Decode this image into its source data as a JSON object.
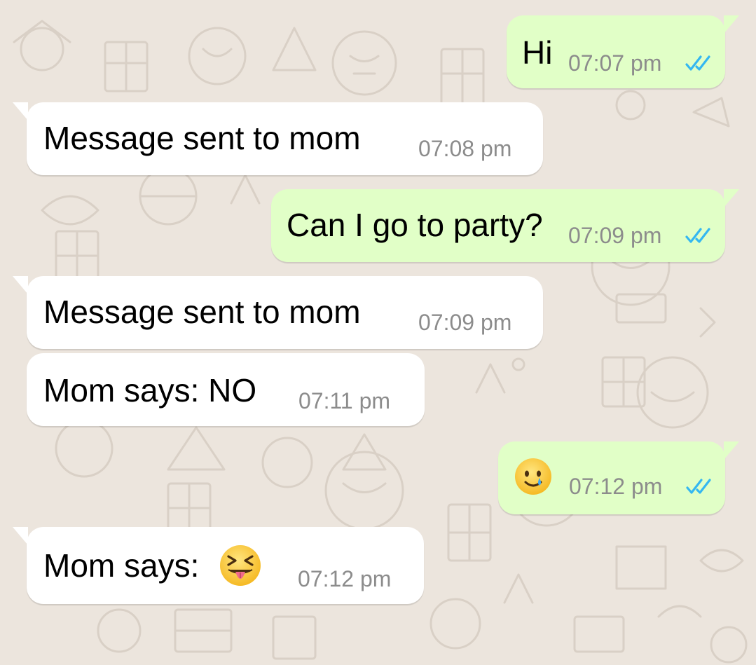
{
  "chat": {
    "messages": [
      {
        "direction": "outgoing",
        "text": "Hi",
        "time": "07:07 pm",
        "status_icon": "double-check-read-icon"
      },
      {
        "direction": "incoming",
        "text": "Message sent to mom",
        "time": "07:08 pm"
      },
      {
        "direction": "outgoing",
        "text": "Can I go to party?",
        "time": "07:09 pm",
        "status_icon": "double-check-read-icon"
      },
      {
        "direction": "incoming",
        "text": "Message sent to mom",
        "time": "07:09 pm"
      },
      {
        "direction": "incoming",
        "text": "Mom says: NO",
        "time": "07:11 pm"
      },
      {
        "direction": "outgoing",
        "emoji": "smiling-face-with-tear-emoji",
        "time": "07:12 pm",
        "status_icon": "double-check-read-icon"
      },
      {
        "direction": "incoming",
        "text": "Mom says:",
        "emoji": "squinting-face-with-tongue-emoji",
        "time": "07:12 pm"
      }
    ]
  },
  "colors": {
    "background": "#ece5dd",
    "incoming_bubble": "#ffffff",
    "outgoing_bubble": "#e1ffc7",
    "read_ticks": "#34b7f1",
    "timestamp": "#8c8c8c"
  }
}
